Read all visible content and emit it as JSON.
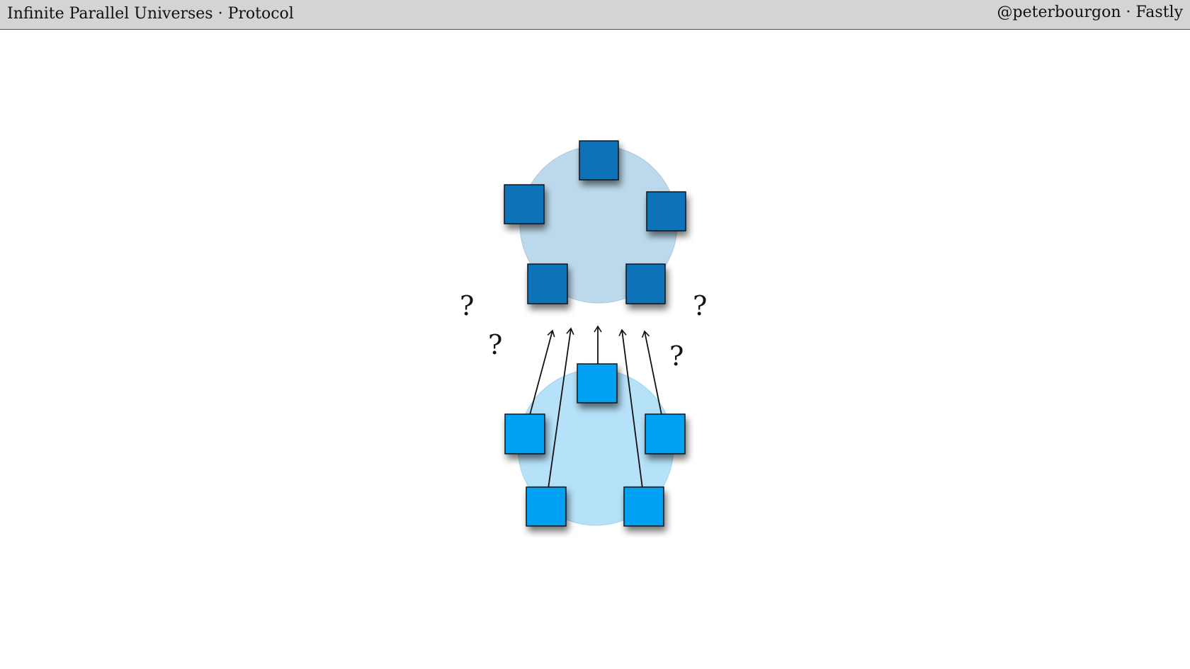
{
  "header": {
    "title": "Infinite Parallel Universes · Protocol",
    "author": "@peterbourgon · Fastly"
  },
  "diagram": {
    "colors": {
      "upper_cluster": "#bcd9ec",
      "upper_node": "#0a72b8",
      "lower_cluster": "#b5e1f9",
      "lower_node": "#04a1f3",
      "stroke": "#111111"
    },
    "upper_cluster": {
      "nodes": [
        "node-1",
        "node-2",
        "node-3",
        "node-4",
        "node-5"
      ]
    },
    "lower_cluster": {
      "nodes": [
        "node-1",
        "node-2",
        "node-3",
        "node-4",
        "node-5"
      ]
    },
    "question_marks": [
      "?",
      "?",
      "?",
      "?"
    ]
  }
}
